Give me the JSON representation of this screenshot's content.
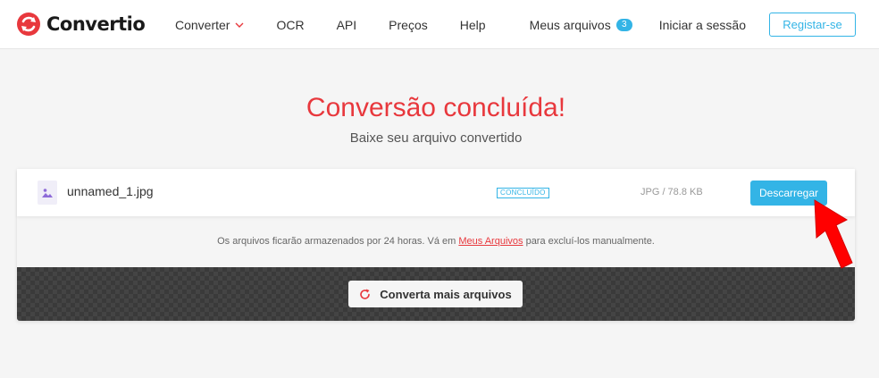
{
  "header": {
    "brand": "Convertio",
    "nav": [
      {
        "label": "Converter",
        "has_dropdown": true
      },
      {
        "label": "OCR"
      },
      {
        "label": "API"
      },
      {
        "label": "Preços"
      },
      {
        "label": "Help"
      }
    ],
    "my_files_label": "Meus arquivos",
    "my_files_count": "3",
    "login_label": "Iniciar a sessão",
    "register_label": "Registar-se"
  },
  "hero": {
    "title": "Conversão concluída!",
    "subtitle": "Baixe seu arquivo convertido"
  },
  "file": {
    "name": "unnamed_1.jpg",
    "status": "CONCLUÍDO",
    "meta": "JPG / 78.8 KB",
    "download_label": "Descarregar",
    "icon": "image-icon"
  },
  "note": {
    "before": "Os arquivos ficarão armazenados por 24 horas. Vá em ",
    "link": "Meus Arquivos",
    "after": " para excluí-los manualmente."
  },
  "more_button_label": "Converta mais arquivos",
  "colors": {
    "brand_red": "#e8383d",
    "accent_blue": "#33b4e6",
    "annotation_arrow": "#ff0000"
  }
}
